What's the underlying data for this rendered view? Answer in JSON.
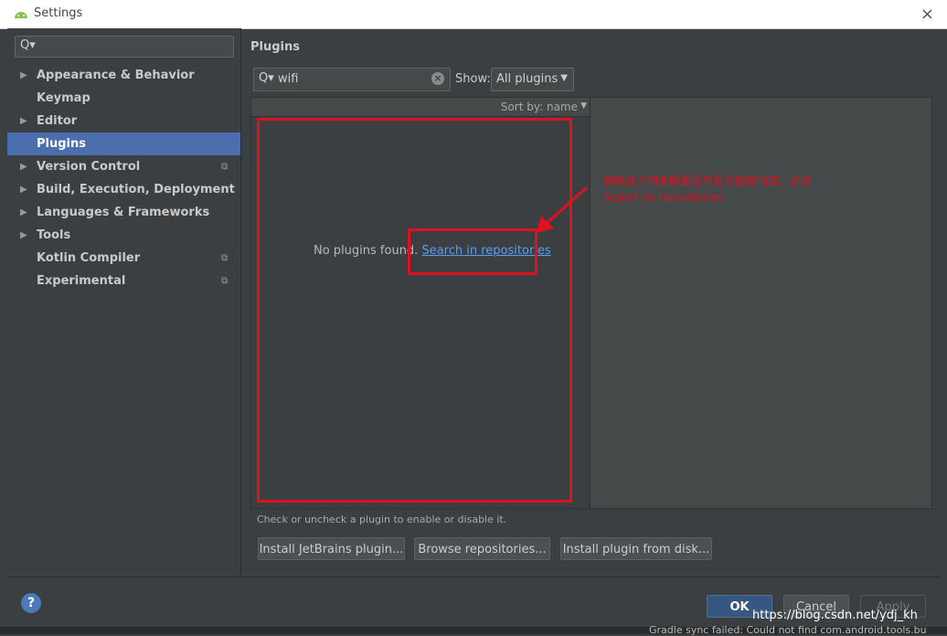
{
  "window": {
    "title": "Settings",
    "close_icon": "×"
  },
  "sidebar": {
    "search_icon": "Q▾",
    "items": [
      {
        "label": "Appearance & Behavior",
        "arrow": "▶",
        "proj": ""
      },
      {
        "label": "Keymap",
        "arrow": "",
        "proj": ""
      },
      {
        "label": "Editor",
        "arrow": "▶",
        "proj": ""
      },
      {
        "label": "Plugins",
        "arrow": "",
        "proj": ""
      },
      {
        "label": "Version Control",
        "arrow": "▶",
        "proj": "⧉"
      },
      {
        "label": "Build, Execution, Deployment",
        "arrow": "▶",
        "proj": ""
      },
      {
        "label": "Languages & Frameworks",
        "arrow": "▶",
        "proj": ""
      },
      {
        "label": "Tools",
        "arrow": "▶",
        "proj": ""
      },
      {
        "label": "Kotlin Compiler",
        "arrow": "",
        "proj": "⧉"
      },
      {
        "label": "Experimental",
        "arrow": "",
        "proj": "⧉"
      }
    ]
  },
  "main": {
    "title": "Plugins",
    "search": {
      "icon": "Q▾",
      "value": "wifi",
      "clear_icon": "×"
    },
    "show": {
      "label": "Show:",
      "selected": "All plugins",
      "dropdown_icon": "▼"
    },
    "sort": {
      "label": "Sort by: name",
      "dropdown_icon": "▼"
    },
    "empty_text": "No plugins found.",
    "empty_link": "Search in repositories",
    "hint": "Check or uncheck a plugin to enable or disable it.",
    "buttons": {
      "install_jetbrains": "Install JetBrains plugin...",
      "browse": "Browse repositories...",
      "install_disk": "Install plugin from disk..."
    }
  },
  "footer": {
    "help": "?",
    "ok": "OK",
    "cancel": "Cancel",
    "apply": "Apply"
  },
  "annotation": {
    "line1": "如果这个列表框里没有显示搜索内容，点击",
    "line2": "Search in repositories"
  },
  "watermark": "https://blog.csdn.net/ydj_kh",
  "background_text": "Gradle sync failed: Could not find com.android.tools.bu",
  "colors": {
    "selected": "#4b6eaf",
    "link": "#589df6",
    "annotation": "#e0101e",
    "ok": "#365880"
  }
}
